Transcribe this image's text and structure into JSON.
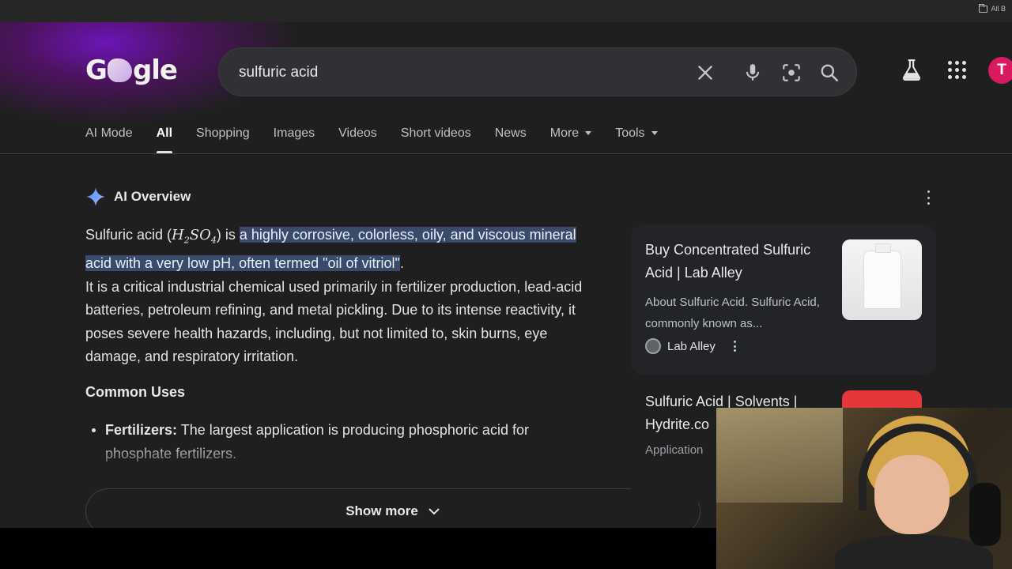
{
  "browser": {
    "bookmarks_label": "All B"
  },
  "search": {
    "query": "sulfuric acid",
    "logo_text": [
      "G",
      "gle"
    ]
  },
  "user": {
    "avatar_initial": "T",
    "avatar_color": "#d81b60"
  },
  "tabs": [
    {
      "label": "AI Mode",
      "active": false
    },
    {
      "label": "All",
      "active": true
    },
    {
      "label": "Shopping",
      "active": false
    },
    {
      "label": "Images",
      "active": false
    },
    {
      "label": "Videos",
      "active": false
    },
    {
      "label": "Short videos",
      "active": false
    },
    {
      "label": "News",
      "active": false
    },
    {
      "label": "More",
      "active": false,
      "dropdown": true
    },
    {
      "label": "Tools",
      "active": false,
      "dropdown": true
    }
  ],
  "ai_overview": {
    "title": "AI Overview",
    "intro_prefix": "Sulfuric acid (",
    "formula": {
      "h": "H",
      "h_sub": "2",
      "so": "SO",
      "o_sub": "4"
    },
    "intro_mid": ") is ",
    "highlighted": "a highly corrosive, colorless, oily, and viscous mineral acid with a very low pH, often termed \"oil of vitriol\"",
    "intro_end": ".",
    "paragraph2": "It is a critical industrial chemical used primarily in fertilizer production, lead-acid batteries, petroleum refining, and metal pickling. Due to its intense reactivity, it poses severe health hazards, including, but not limited to, skin burns, eye damage, and respiratory irritation.",
    "section_heading": "Common Uses",
    "bullet_label": "Fertilizers:",
    "bullet_text": " The largest application is producing phosphoric acid for phosphate fertilizers.",
    "show_more": "Show more"
  },
  "sources": [
    {
      "title": "Buy Concentrated Sulfuric Acid | Lab Alley",
      "snippet": "About Sulfuric Acid. Sulfuric Acid, commonly known as...",
      "site": "Lab Alley"
    },
    {
      "title": "Sulfuric Acid | Solvents | Hydrite.co",
      "snippet": "Application"
    }
  ],
  "colors": {
    "background": "#1f1f1f",
    "highlight": "#3a4a6b",
    "accent_red": "#e5373a"
  }
}
